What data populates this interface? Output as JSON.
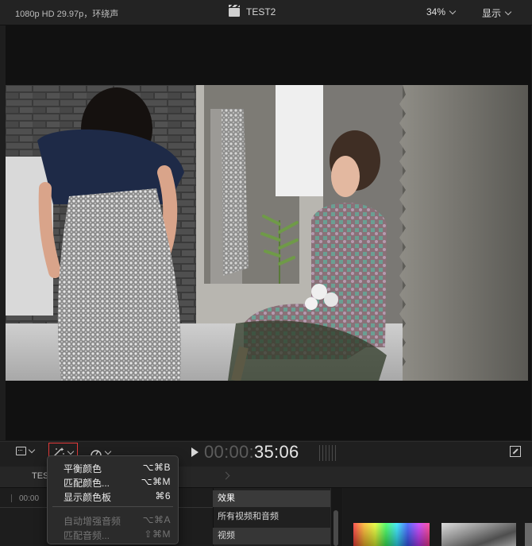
{
  "topbar": {
    "format_info": "1080p HD 29.97p，环绕声",
    "project_title": "TEST2",
    "zoom": "34%",
    "display_label": "显示"
  },
  "controls": {
    "timecode_dim": "00:00:",
    "timecode_bright": "35:06"
  },
  "menu": {
    "items": [
      {
        "label": "平衡颜色",
        "shortcut": "⌥⌘B",
        "enabled": true
      },
      {
        "label": "匹配颜色...",
        "shortcut": "⌥⌘M",
        "enabled": true
      },
      {
        "label": "显示颜色板",
        "shortcut": "⌘6",
        "enabled": true
      },
      {
        "label": "自动增强音频",
        "shortcut": "⌥⌘A",
        "enabled": false
      },
      {
        "label": "匹配音频...",
        "shortcut": "⇧⌘M",
        "enabled": false
      }
    ]
  },
  "lower": {
    "tab_label": "TES",
    "ruler_time": "00:00",
    "browser": {
      "header": "效果",
      "items": [
        "所有视频和音频",
        "视频"
      ]
    }
  },
  "colors": {
    "accent_highlight": "#e23a3a",
    "background": "#1b1b1b"
  }
}
